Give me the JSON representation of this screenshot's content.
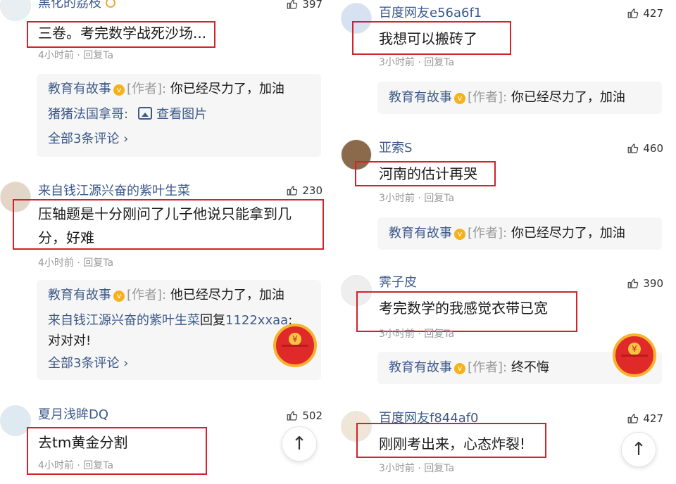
{
  "left": {
    "c1": {
      "user": "黑化的荔枝",
      "likes": "397",
      "text": "三卷。考完数学战死沙场...",
      "time": "4小时前",
      "reply": "回复Ta",
      "replies": [
        {
          "name": "教育有故事",
          "tag": "[作者]:",
          "text": "你已经尽力了，加油"
        },
        {
          "name": "猪猪法国拿哥:",
          "link": "查看图片"
        }
      ],
      "all": "全部3条评论 ›"
    },
    "c2": {
      "user": "来自钱江源兴奋的紫叶生菜",
      "likes": "230",
      "line1": "压轴题是十分刚问了儿子他说只能拿到几",
      "line2": "分，好难",
      "time": "4小时前",
      "reply": "回复Ta",
      "replies": [
        {
          "name": "教育有故事",
          "tag": "[作者]:",
          "text": "他已经尽力了，加油"
        },
        {
          "name": "来自钱江源兴奋的紫叶生菜",
          "mid": "回复",
          "target": "1122xxaa",
          "text": ":",
          "cont": "对对对!"
        }
      ],
      "all": "全部3条评论 ›"
    },
    "c3": {
      "user": "夏月浅眸DQ",
      "likes": "502",
      "text": "去tm黄金分割",
      "time": "4小时前",
      "reply": "回复Ta"
    }
  },
  "right": {
    "c1": {
      "user": "百度网友e56a6f1",
      "likes": "427",
      "text": "我想可以搬砖了",
      "time": "3小时前",
      "reply": "回复Ta",
      "r": {
        "name": "教育有故事",
        "tag": "[作者]:",
        "text": "你已经尽力了，加油"
      }
    },
    "c2": {
      "user": "亚索S",
      "likes": "460",
      "text": "河南的估计再哭",
      "time": "3小时前",
      "reply": "回复Ta",
      "r": {
        "name": "教育有故事",
        "tag": "[作者]:",
        "text": "你已经尽力了，加油"
      }
    },
    "c3": {
      "user": "霁子皮",
      "likes": "390",
      "text": "考完数学的我感觉衣带已宽",
      "time": "3小时前",
      "reply": "回复Ta",
      "r": {
        "name": "教育有故事",
        "tag": "[作者]:",
        "text": "终不悔"
      }
    },
    "c4": {
      "user": "百度网友f844af0",
      "likes": "427",
      "text": "刚刚考出来，心态炸裂!",
      "time": "3小时前",
      "reply": "回复Ta"
    }
  },
  "icons": {
    "like": "thumbs-up-icon",
    "verified": "verified-badge-icon",
    "top": "back-to-top-icon",
    "redpacket": "red-packet-icon"
  },
  "badge_glyph": "v",
  "coin_glyph": "¥",
  "top_glyph": "↑",
  "colors": {
    "username": "#3d5a8a",
    "highlight": "#d4212b",
    "reply_bg": "#f6f6f6",
    "meta": "#9a9a9a"
  }
}
